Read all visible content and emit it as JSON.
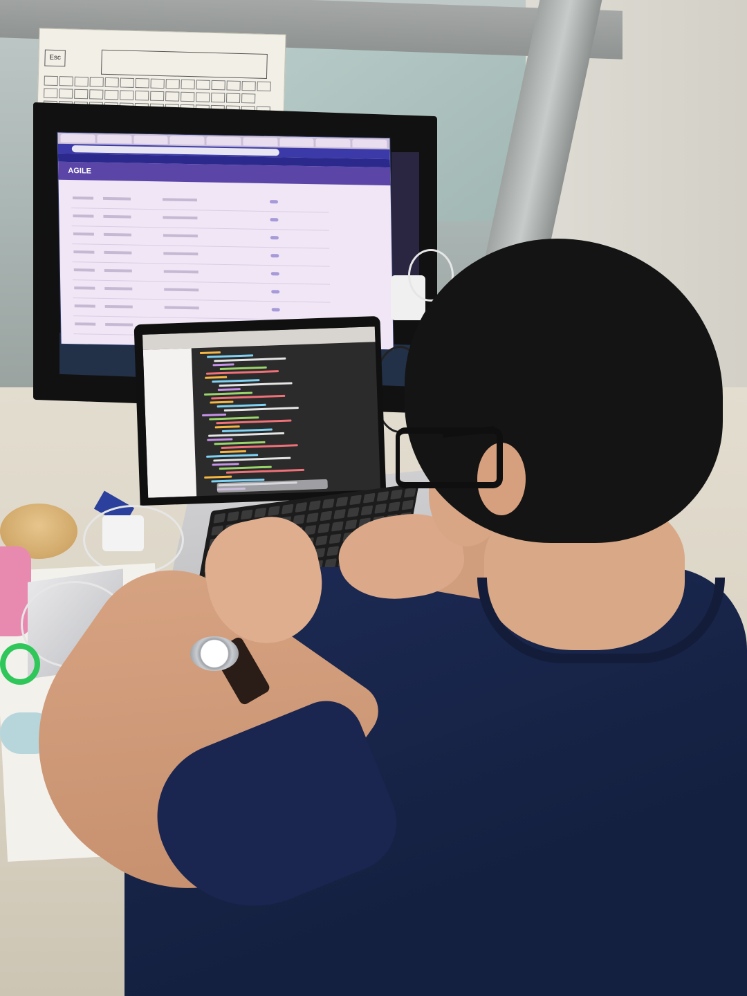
{
  "scene": {
    "description_labels": {
      "card_esc_key": "Esc"
    },
    "monitor": {
      "app_title": "AGILE"
    }
  },
  "colors": {
    "shirt": "#1d2a55",
    "hair": "#141414",
    "skin": "#d8a585",
    "desk": "#e3ddd0",
    "monitor_header": "#5b46a8",
    "code_background": "#2b2b2b"
  }
}
